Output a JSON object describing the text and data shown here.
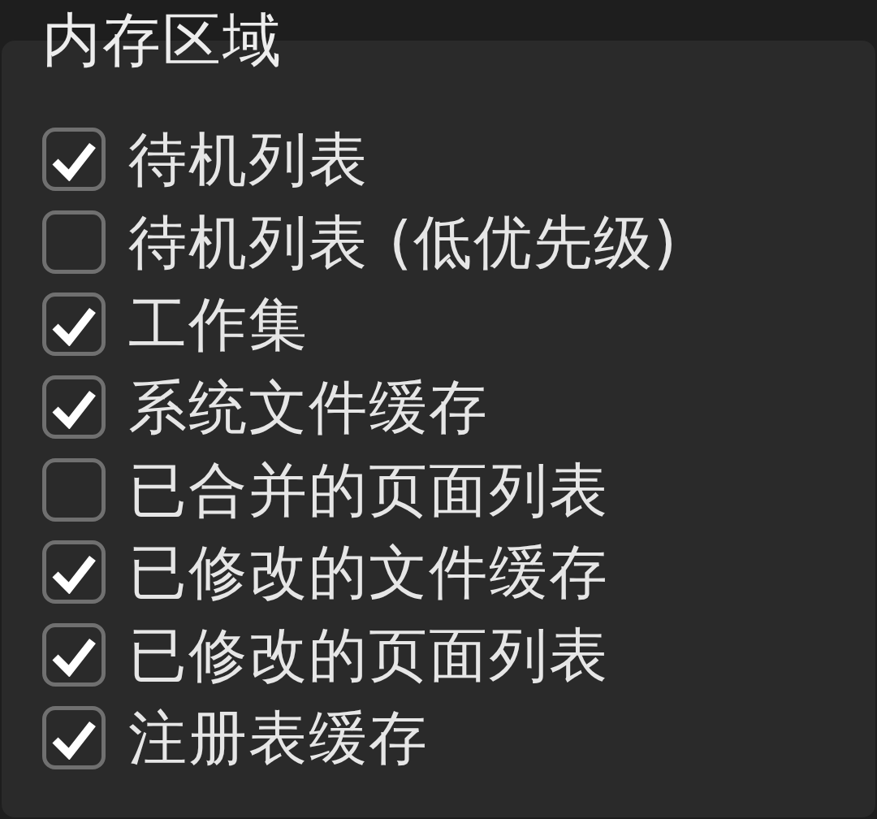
{
  "group": {
    "title": "内存区域"
  },
  "items": [
    {
      "label": "待机列表",
      "checked": true
    },
    {
      "label": "待机列表 (低优先级)",
      "checked": false
    },
    {
      "label": "工作集",
      "checked": true
    },
    {
      "label": "系统文件缓存",
      "checked": true
    },
    {
      "label": "已合并的页面列表",
      "checked": false
    },
    {
      "label": "已修改的文件缓存",
      "checked": true
    },
    {
      "label": "已修改的页面列表",
      "checked": true
    },
    {
      "label": "注册表缓存",
      "checked": true
    }
  ]
}
